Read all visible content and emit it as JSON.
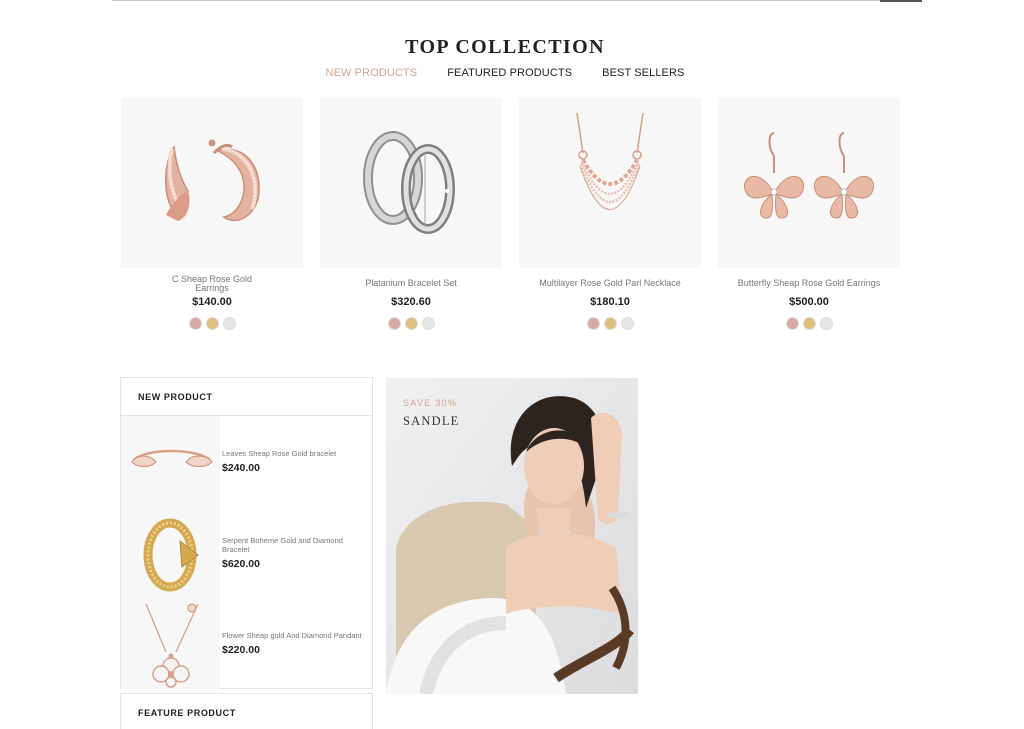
{
  "collection": {
    "title": "TOP COLLECTION",
    "tabs": [
      {
        "label": "NEW PRODUCTS",
        "active": true
      },
      {
        "label": "FEATURED PRODUCTS",
        "active": false
      },
      {
        "label": "BEST SELLERS",
        "active": false
      }
    ],
    "products": [
      {
        "name": "C Sheap Rose Gold Earrings",
        "price": "$140.00",
        "icon": "hoop-earrings-image"
      },
      {
        "name": "Platanium Bracelet Set",
        "price": "$320.60",
        "icon": "wedding-rings-image"
      },
      {
        "name": "Multilayer Rose Gold Parl Necklace",
        "price": "$180.10",
        "icon": "pearl-necklace-image"
      },
      {
        "name": "Butterfly Sheap Rose Gold Earrings",
        "price": "$500.00",
        "icon": "butterfly-earrings-image"
      }
    ],
    "swatch_colors": [
      "#d9a9a3",
      "#dcc07b",
      "#e6e6e6"
    ]
  },
  "new_product": {
    "title": "NEW PRODUCT",
    "items": [
      {
        "name": "Leaves Sheap Rose Gold bracelet",
        "price": "$240.00"
      },
      {
        "name": "Serpent Boheme Gold and Diamond Bracelet",
        "price": "$620.00"
      },
      {
        "name": "Flower Sheap gold And Diamond Pandant",
        "price": "$220.00"
      }
    ]
  },
  "feature_product": {
    "title": "FEATURE PRODUCT"
  },
  "banner": {
    "save_text": "SAVE 30%",
    "title": "SANDLE"
  },
  "colors": {
    "accent": "#d4a58e",
    "rose_gold": "#d9a08a",
    "gold": "#d4a94f",
    "silver": "#b9b9b9"
  }
}
